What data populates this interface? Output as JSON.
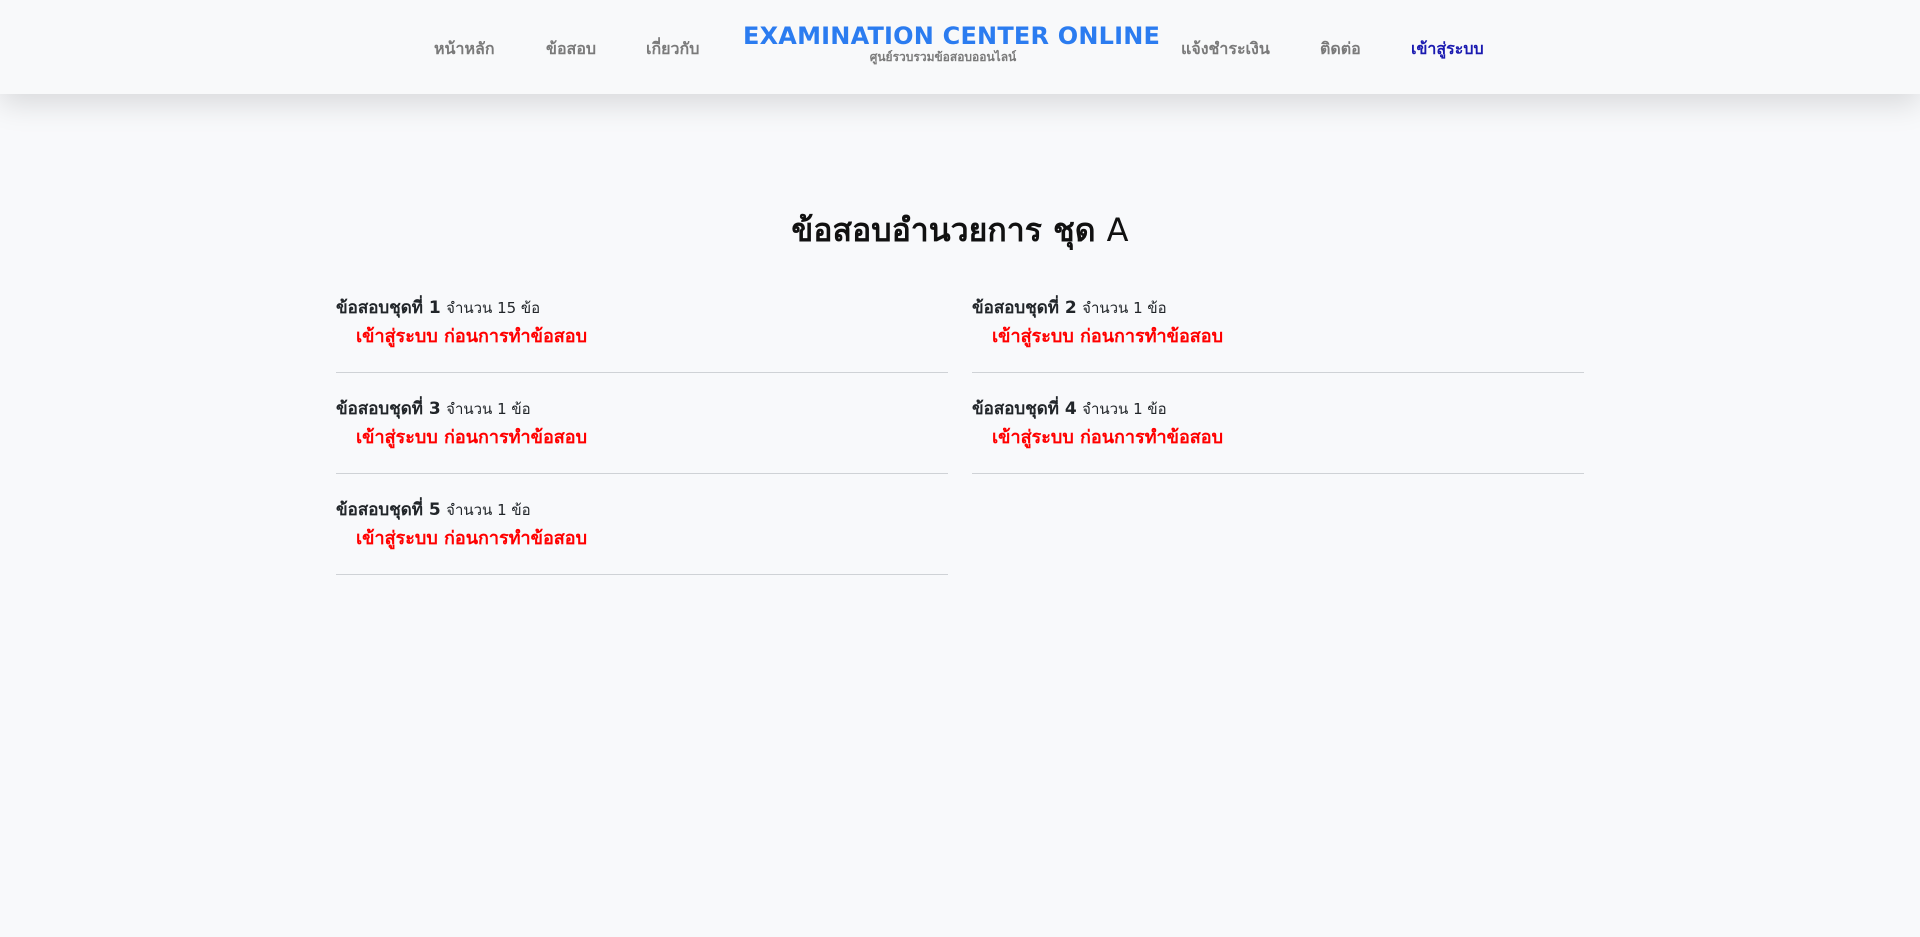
{
  "navbar": {
    "items_left": [
      {
        "label": "หน้าหลัก"
      },
      {
        "label": "ข้อสอบ"
      },
      {
        "label": "เกี่ยวกับ"
      }
    ],
    "brand": {
      "title": "EXAMINATION CENTER ONLINE",
      "subtitle": "ศูนย์รวบรวมข้อสอบออนไลน์"
    },
    "items_right": [
      {
        "label": "แจ้งชำระเงิน"
      },
      {
        "label": "ติดต่อ"
      },
      {
        "label": "เข้าสู่ระบบ"
      }
    ],
    "active_color": "#1a1ab0",
    "link_color": "#7a7a7a",
    "brand_color": "#2b7cf0"
  },
  "page": {
    "title_main": "ข้อสอบอำนวยการ ชุด",
    "title_suffix": "A"
  },
  "exams": [
    {
      "name": "ข้อสอบชุดที่ 1",
      "count": "จำนวน 15 ข้อ",
      "login_text": "เข้าสู่ระบบ ก่อนการทำข้อสอบ"
    },
    {
      "name": "ข้อสอบชุดที่ 2",
      "count": "จำนวน 1 ข้อ",
      "login_text": "เข้าสู่ระบบ ก่อนการทำข้อสอบ"
    },
    {
      "name": "ข้อสอบชุดที่ 3",
      "count": "จำนวน 1 ข้อ",
      "login_text": "เข้าสู่ระบบ ก่อนการทำข้อสอบ"
    },
    {
      "name": "ข้อสอบชุดที่ 4",
      "count": "จำนวน 1 ข้อ",
      "login_text": "เข้าสู่ระบบ ก่อนการทำข้อสอบ"
    },
    {
      "name": "ข้อสอบชุดที่ 5",
      "count": "จำนวน 1 ข้อ",
      "login_text": "เข้าสู่ระบบ ก่อนการทำข้อสอบ"
    }
  ],
  "colors": {
    "login_prompt": "#ff0000",
    "background": "#f8f9fb",
    "divider": "#cfd2d6"
  }
}
